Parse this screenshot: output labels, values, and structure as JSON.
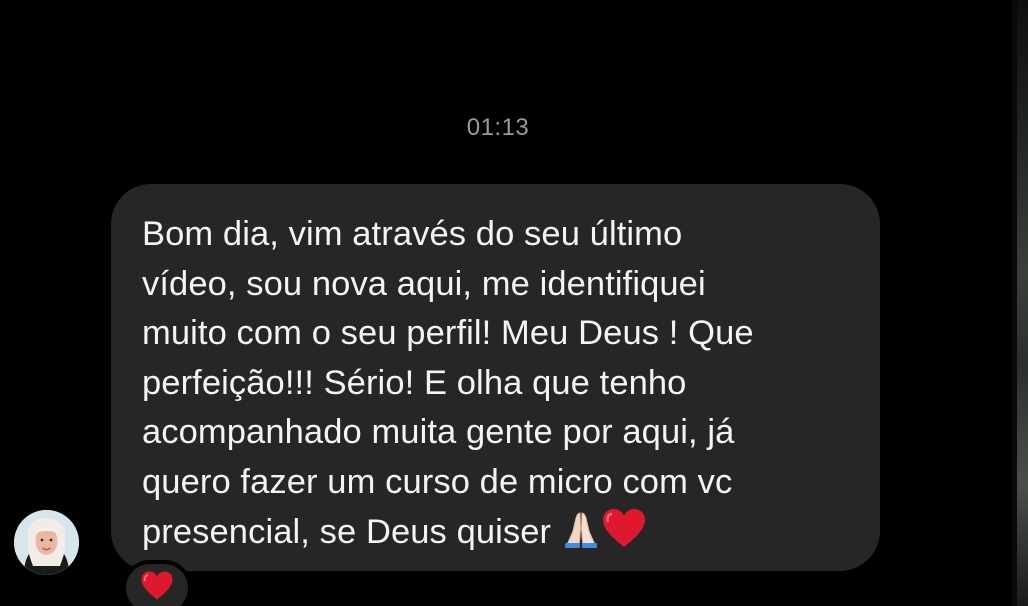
{
  "conversation": {
    "timestamp": "01:13"
  },
  "message": {
    "text": "Bom dia, vim através do seu último\nvídeo, sou nova aqui, me identifiquei\nmuito com o seu perfil! Meu Deus ! Que\nperfeição!!! Sério! E olha que tenho\nacompanhado muita gente por aqui, já\nquero fazer um curso de micro com vc\npresencial, se Deus quiser ",
    "trailing_emojis": [
      "folded-hands-icon",
      "red-heart-icon"
    ],
    "reaction_emoji": "red-heart-icon"
  },
  "colors": {
    "background": "#000000",
    "bubble": "#262626",
    "text": "#f4f4f4",
    "timestamp": "#9a9a9a",
    "heart": "#e0182d"
  }
}
